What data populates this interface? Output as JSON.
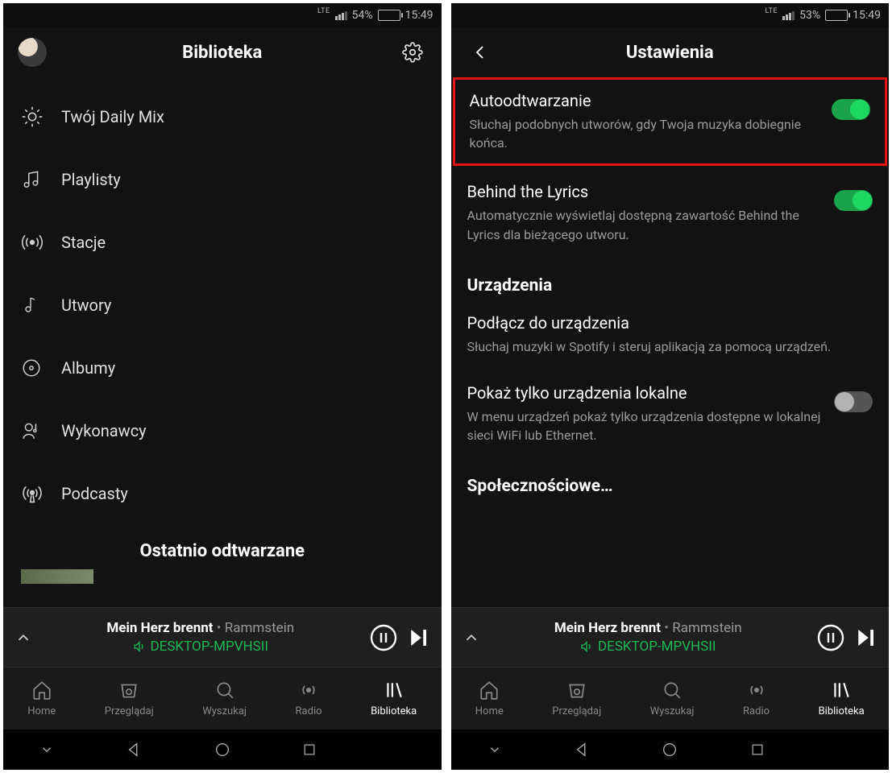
{
  "left": {
    "status": {
      "lte": "LTE",
      "battery_pct": "54%",
      "time": "15:49",
      "battery_fill_pct": 54
    },
    "header": {
      "title": "Biblioteka"
    },
    "library_items": [
      {
        "label": "Twój Daily Mix"
      },
      {
        "label": "Playlisty"
      },
      {
        "label": "Stacje"
      },
      {
        "label": "Utwory"
      },
      {
        "label": "Albumy"
      },
      {
        "label": "Wykonawcy"
      },
      {
        "label": "Podcasty"
      }
    ],
    "recently_played_heading": "Ostatnio odtwarzane"
  },
  "right": {
    "status": {
      "lte": "LTE",
      "battery_pct": "53%",
      "time": "15:49",
      "battery_fill_pct": 53
    },
    "header": {
      "title": "Ustawienia"
    },
    "settings": {
      "autoplay": {
        "title": "Autoodtwarzanie",
        "desc": "Słuchaj podobnych utworów, gdy Twoja muzyka dobiegnie końca.",
        "on": true
      },
      "behind_lyrics": {
        "title": "Behind the Lyrics",
        "desc": "Automatycznie wyświetlaj dostępną zawartość Behind the Lyrics dla bieżącego utworu.",
        "on": true
      },
      "devices_heading": "Urządzenia",
      "connect_device": {
        "title": "Podłącz do urządzenia",
        "desc": "Słuchaj muzyki w Spotify i steruj aplikacją za pomocą urządzeń."
      },
      "local_only": {
        "title": "Pokaż tylko urządzenia lokalne",
        "desc": "W menu urządzeń pokaż tylko urządzenia dostępne w lokalnej sieci WiFi lub Ethernet.",
        "on": false
      },
      "social_heading": "Społecznościowe…"
    }
  },
  "now_playing": {
    "song": "Mein Herz brennt",
    "separator": "•",
    "artist": "Rammstein",
    "device": "DESKTOP-MPVHSII"
  },
  "bottom_nav": {
    "home": "Home",
    "browse": "Przeglądaj",
    "search": "Wyszukaj",
    "radio": "Radio",
    "library": "Biblioteka"
  }
}
